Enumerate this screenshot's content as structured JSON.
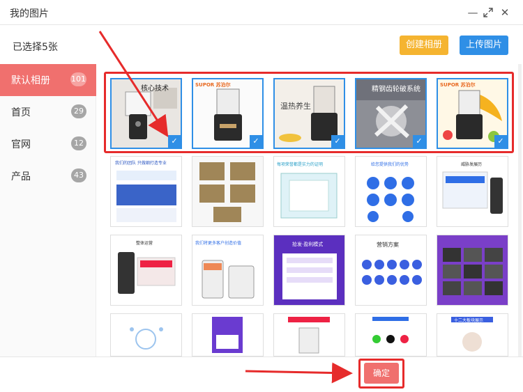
{
  "window": {
    "title": "我的图片",
    "controls": [
      "minimize-icon",
      "maximize-icon",
      "close-icon"
    ]
  },
  "header": {
    "selected_text": "已选择5张",
    "create_album_label": "创建相册",
    "upload_label": "上传图片"
  },
  "sidebar": {
    "items": [
      {
        "label": "默认相册",
        "count": "101",
        "active": true
      },
      {
        "label": "首页",
        "count": "29",
        "active": false
      },
      {
        "label": "官网",
        "count": "12",
        "active": false
      },
      {
        "label": "产品",
        "count": "43",
        "active": false
      }
    ]
  },
  "images": {
    "selected_row": [
      {
        "caption": "核心技术",
        "brand": ""
      },
      {
        "caption": "",
        "brand": "SUPOR 苏泊尔"
      },
      {
        "caption": "温热养生",
        "brand": ""
      },
      {
        "caption": "精钢齿轮破系统",
        "brand": ""
      },
      {
        "caption": "",
        "brand": "SUPOR 苏泊尔"
      }
    ],
    "row2": [
      {
        "caption": "我们的团队 只做细打造专业"
      },
      {
        "caption": ""
      },
      {
        "caption": "每项荣誉都是实力的证明"
      },
      {
        "caption": "给您提供我们的优势"
      },
      {
        "caption": "威胁发展历"
      }
    ],
    "row3": [
      {
        "caption": "整体运营"
      },
      {
        "caption": "我们将更多客户创造价值"
      },
      {
        "caption": "拾发·盈利模式"
      },
      {
        "caption": "营销方案"
      },
      {
        "caption": ""
      }
    ],
    "row4": [
      {
        "caption": ""
      },
      {
        "caption": ""
      },
      {
        "caption": ""
      },
      {
        "caption": ""
      },
      {
        "caption": "十二大板块展示"
      }
    ]
  },
  "footer": {
    "confirm_label": "确定"
  },
  "colors": {
    "accent_red": "#f0706e",
    "primary_blue": "#2f8fe6",
    "create_yellow": "#f5b430",
    "annotation_red": "#e62b2b"
  }
}
